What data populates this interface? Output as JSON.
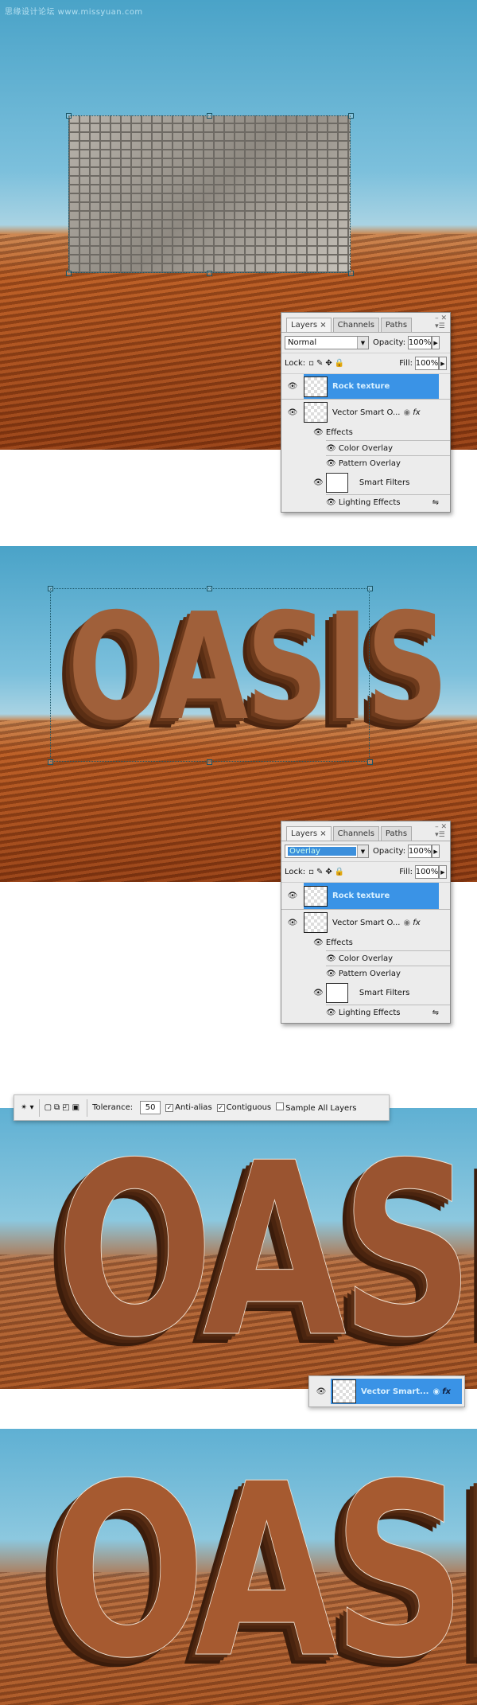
{
  "watermark": "思缘设计论坛 www.missyuan.com",
  "artwork_text": "OASIS",
  "colors": {
    "selection_blue": "#3a93e6",
    "panel_bg": "#ececec",
    "sky": "#7cc0dc",
    "sand": "#b55a22"
  },
  "panel1": {
    "tabs": [
      {
        "label": "Layers ×",
        "active": true
      },
      {
        "label": "Channels"
      },
      {
        "label": "Paths"
      }
    ],
    "blend_mode": "Normal",
    "opacity_label": "Opacity:",
    "opacity": "100%",
    "lock_label": "Lock:",
    "fill_label": "Fill:",
    "fill": "100%",
    "layers": [
      {
        "name": "Rock texture",
        "selected": true,
        "icon": "eye-icon"
      },
      {
        "name": "Vector Smart O...",
        "selected": false,
        "icon": "eye-icon"
      }
    ],
    "sub_items": [
      "Effects",
      "Color Overlay",
      "Pattern Overlay",
      "Smart Filters",
      "Lighting Effects"
    ]
  },
  "panel2": {
    "tabs": [
      {
        "label": "Layers ×",
        "active": true
      },
      {
        "label": "Channels"
      },
      {
        "label": "Paths"
      }
    ],
    "blend_mode": "Overlay",
    "opacity_label": "Opacity:",
    "opacity": "100%",
    "lock_label": "Lock:",
    "fill_label": "Fill:",
    "fill": "100%",
    "layers": [
      {
        "name": "Rock texture",
        "selected": true
      },
      {
        "name": "Vector Smart O...",
        "selected": false
      }
    ],
    "sub_items": [
      "Effects",
      "Color Overlay",
      "Pattern Overlay",
      "Smart Filters",
      "Lighting Effects"
    ]
  },
  "toolbar": {
    "tool_icon": "magic-wand-icon",
    "tolerance_label": "Tolerance:",
    "tolerance": "50",
    "anti_alias": {
      "label": "Anti-alias",
      "checked": true
    },
    "contiguous": {
      "label": "Contiguous",
      "checked": true
    },
    "sample_all": {
      "label": "Sample All Layers",
      "checked": false
    }
  },
  "layer_bar": {
    "name": "Vector Smart...",
    "selected": true
  }
}
